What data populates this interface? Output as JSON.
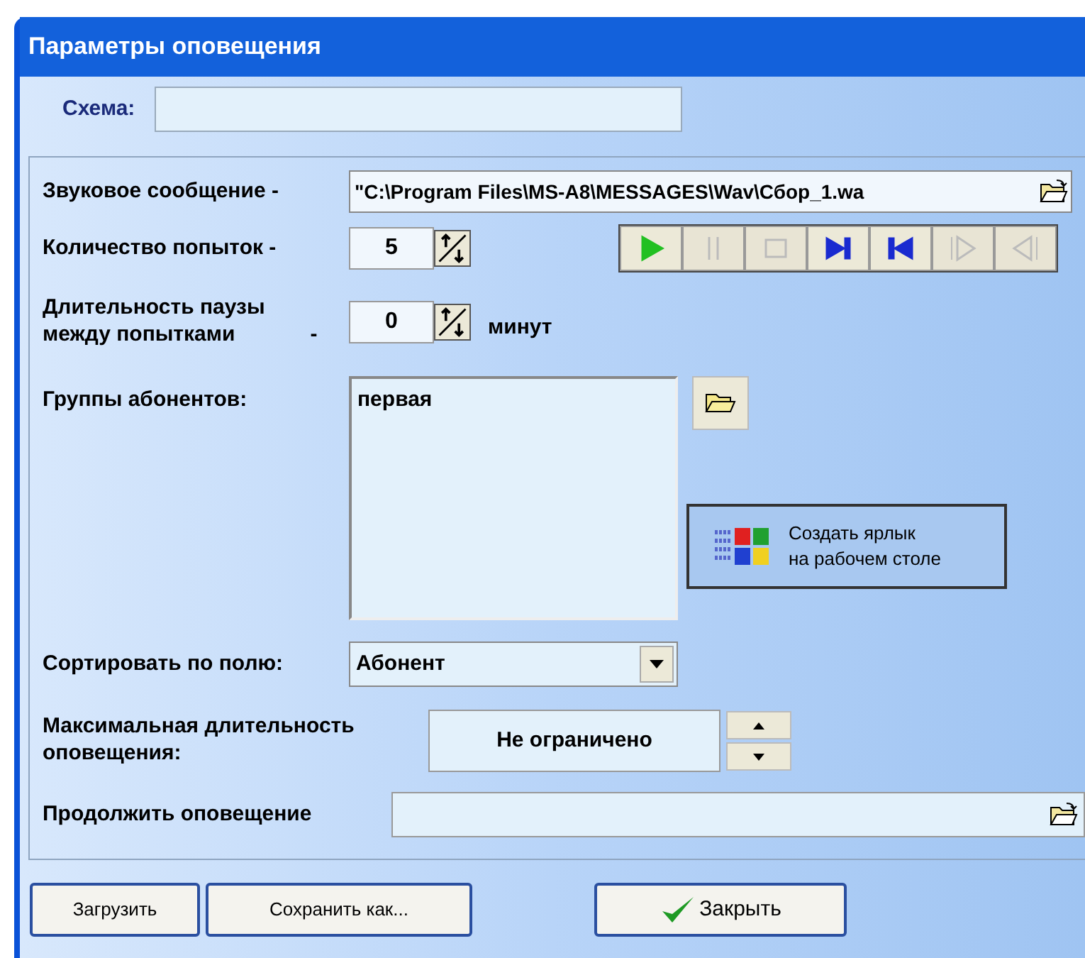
{
  "window": {
    "title": "Параметры оповещения"
  },
  "scheme": {
    "label": "Схема:"
  },
  "sound": {
    "label": "Звуковое сообщение -",
    "value": "\"C:\\Program Files\\MS-A8\\MESSAGES\\Wav\\Сбор_1.wa"
  },
  "player": [
    {
      "kind": "play",
      "disabled": false
    },
    {
      "kind": "pause",
      "disabled": true
    },
    {
      "kind": "stop",
      "disabled": true
    },
    {
      "kind": "next",
      "disabled": false
    },
    {
      "kind": "prev",
      "disabled": false
    },
    {
      "kind": "step-forward",
      "disabled": true
    },
    {
      "kind": "step-back",
      "disabled": true
    }
  ],
  "attempts": {
    "label": "Количество попыток -",
    "value": "5"
  },
  "pause": {
    "label_lines": [
      "Длительность паузы",
      "между попытками"
    ],
    "dash": "-",
    "value": "0",
    "unit": "минут"
  },
  "groups": {
    "label": "Группы абонентов:",
    "items": [
      "первая"
    ]
  },
  "shortcut": {
    "lines": [
      "Создать ярлык",
      "на рабочем столе"
    ]
  },
  "sort": {
    "label": "Сортировать по полю:",
    "value": "Абонент"
  },
  "max_duration": {
    "label_lines": [
      "Максимальная длительность",
      "оповещения:"
    ],
    "value": "Не ограничено"
  },
  "continue": {
    "label": "Продолжить оповещение"
  },
  "buttons": [
    {
      "kind": "plain",
      "label": "Загрузить"
    },
    {
      "kind": "plain",
      "label": "Сохранить как..."
    },
    {
      "kind": "close",
      "label": "Закрыть"
    }
  ]
}
